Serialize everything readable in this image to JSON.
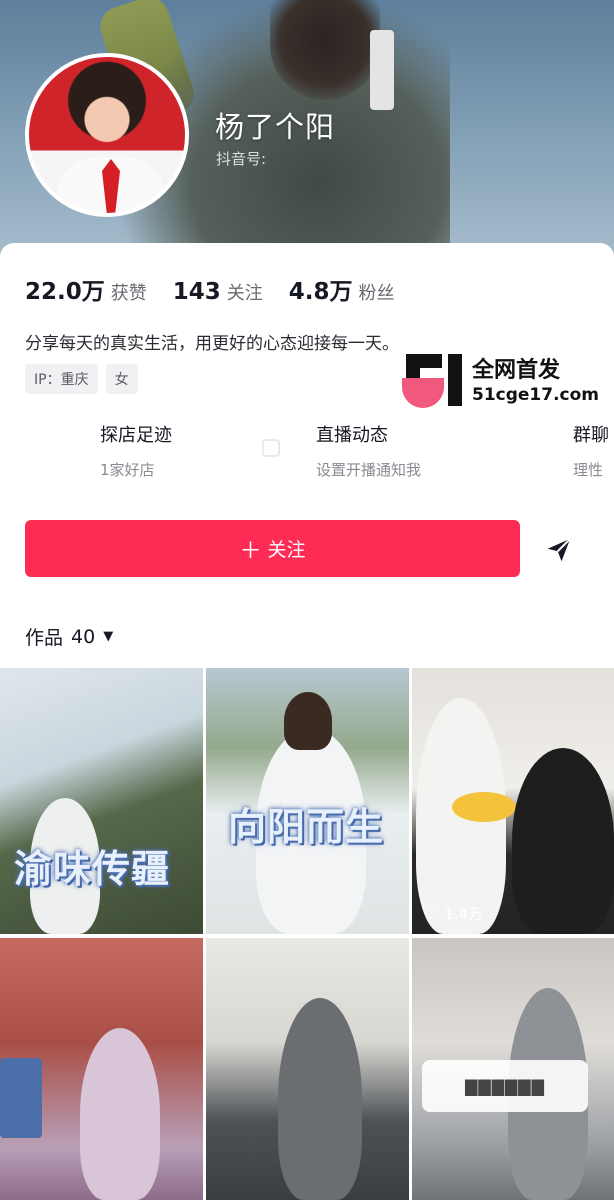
{
  "profile": {
    "nickname": "杨了个阳",
    "douyin_id_label": "抖音号:",
    "stats": [
      {
        "value": "22.0万",
        "label": "获赞"
      },
      {
        "value": "143",
        "label": "关注"
      },
      {
        "value": "4.8万",
        "label": "粉丝"
      }
    ],
    "bio": "分享每天的真实生活，用更好的心态迎接每一天。",
    "tags": [
      "IP：重庆",
      "女"
    ]
  },
  "watermark": {
    "title": "全网首发",
    "url": "51cge17.com"
  },
  "services": [
    {
      "title": "探店足迹",
      "subtitle": "1家好店"
    },
    {
      "title": "直播动态",
      "subtitle": "设置开播通知我"
    },
    {
      "title": "群聊",
      "subtitle": "理性"
    }
  ],
  "actions": {
    "follow_label": "关注",
    "follow_icon": "plus-icon",
    "share_icon": "send-icon"
  },
  "works": {
    "label": "作品",
    "count": "40"
  },
  "videos": [
    {
      "cover_text": "渝味传疆",
      "likes": ""
    },
    {
      "cover_text": "向阳而生",
      "likes": ""
    },
    {
      "cover_text": "",
      "likes": "1.4万"
    },
    {
      "cover_text": "",
      "likes": ""
    },
    {
      "cover_text": "",
      "likes": ""
    },
    {
      "cover_text": "",
      "likes": ""
    }
  ],
  "colors": {
    "accent": "#fe2c55",
    "watermark_pink": "#f0587d"
  }
}
